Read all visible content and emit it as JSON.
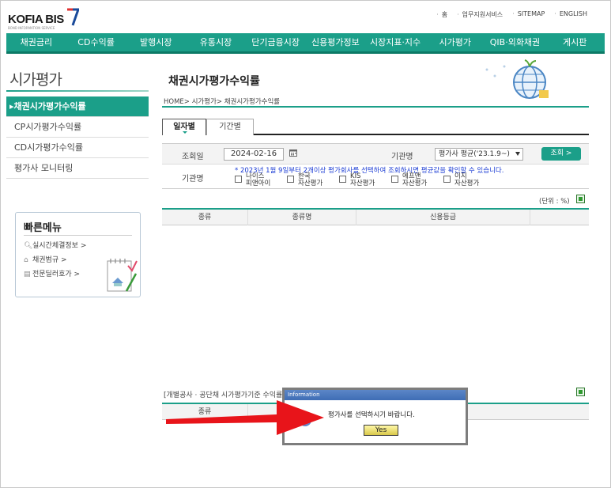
{
  "header": {
    "logo_text": "KOFIA BIS",
    "logo_sub": "BOND INFORMATION SERVICE",
    "links": [
      "홈",
      "업무지원서비스",
      "SITEMAP",
      "ENGLISH"
    ]
  },
  "nav": [
    "채권금리",
    "CD수익률",
    "발행시장",
    "유통시장",
    "단기금융시장",
    "신용평가정보",
    "시장지표·지수",
    "시가평가",
    "QIB·외화채권",
    "게시판"
  ],
  "sidebar": {
    "title": "시가평가",
    "items": [
      {
        "label": "채권시가평가수익률",
        "active": true
      },
      {
        "label": "CP시가평가수익률",
        "active": false
      },
      {
        "label": "CD시가평가수익률",
        "active": false
      },
      {
        "label": "평가사 모니터링",
        "active": false
      }
    ]
  },
  "quick": {
    "title": "빠른메뉴",
    "links": [
      "실시간체결정보 >",
      "채권범규 >",
      "전문딜러호가 >"
    ]
  },
  "main": {
    "title": "채권시가평가수익률",
    "breadcrumb": "HOME> 시가평가> 채권시가평가수익률",
    "tabs": [
      "일자별",
      "기간별"
    ],
    "search": {
      "date_label": "조회일",
      "date_value": "2024-02-16",
      "agency_label": "기관명",
      "agency_select": "평가사 평균('23.1.9~)",
      "search_button": "조회 >",
      "agency_label2": "기관명",
      "notice": "* 2023년 1월 9일부터 2개이상 평가회사를 선택하여 조회하시면 평균값을 확인할 수 있습니다.",
      "agencies": [
        [
          "나이스",
          "피앤아이"
        ],
        [
          "한국",
          "자산평가"
        ],
        [
          "KIS",
          "자산평가"
        ],
        [
          "에프앤",
          "자산평가"
        ],
        [
          "이지",
          "자산평가"
        ]
      ]
    },
    "unit": "(단위 : %)",
    "table_headers": [
      "종류",
      "종류명",
      "신용등급"
    ],
    "sub_caption": "[개별공사 · 공단채 시가평가기준 수익률",
    "table2_headers": [
      "종류"
    ]
  },
  "dialog": {
    "title": "Information",
    "message": "평가사를 선택하시기 바랍니다.",
    "button": "Yes"
  },
  "colors": {
    "accent": "#1b9f89",
    "notice": "#1a3bd4",
    "arrow": "#e8141a"
  }
}
